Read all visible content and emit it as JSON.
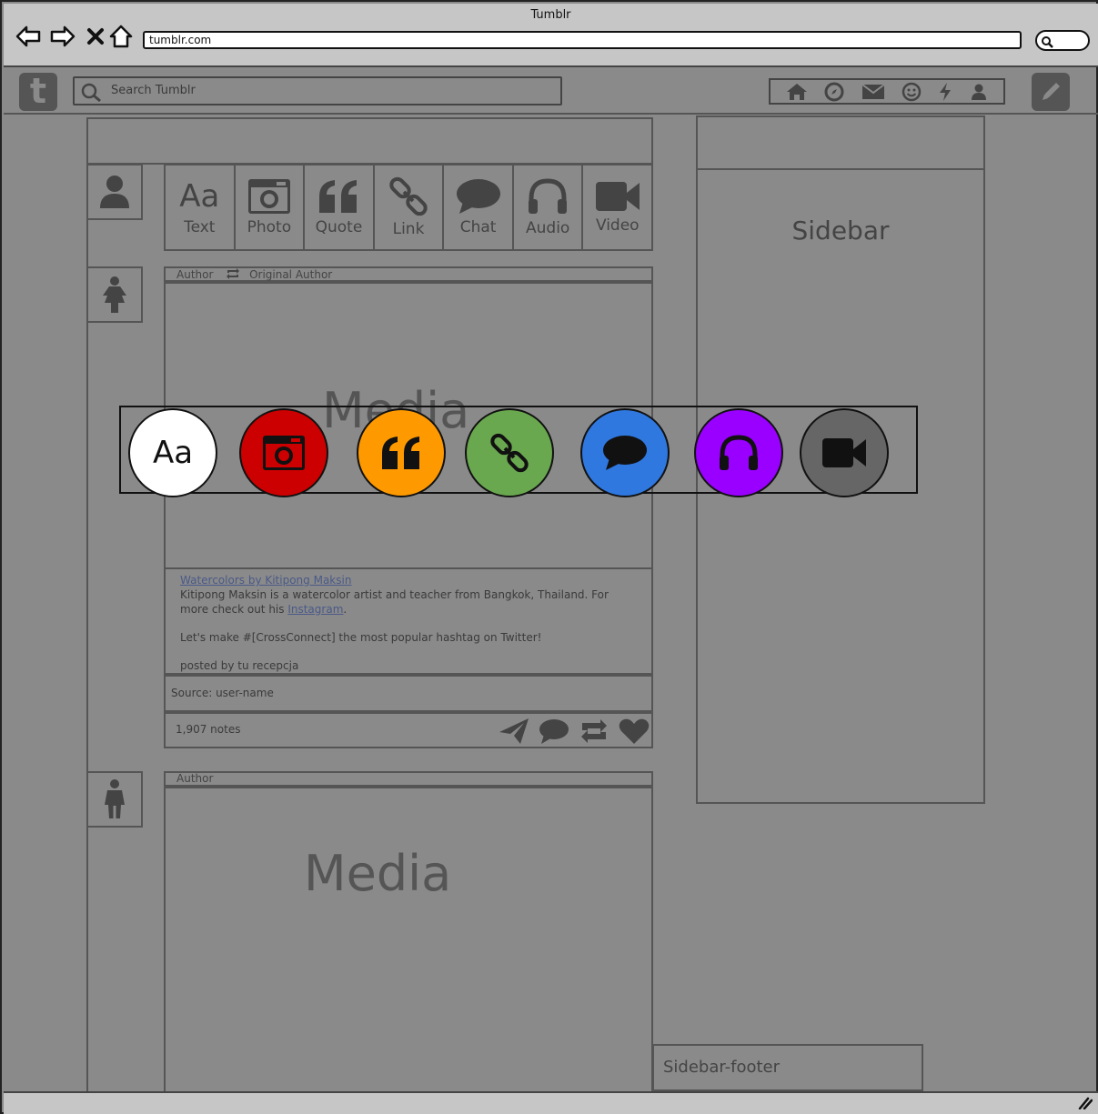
{
  "window": {
    "title": "Tumblr",
    "url": "tumblr.com"
  },
  "header": {
    "search_placeholder": "Search Tumblr"
  },
  "post_types": [
    {
      "label": "Text",
      "glyph": "Aa"
    },
    {
      "label": "Photo"
    },
    {
      "label": "Quote"
    },
    {
      "label": "Link"
    },
    {
      "label": "Chat"
    },
    {
      "label": "Audio"
    },
    {
      "label": "Video"
    }
  ],
  "post1": {
    "author": "Author",
    "original_author": "Original Author",
    "media": "Media",
    "caption_link": "Watercolors by Kitipong Maksin",
    "caption_text": " Kitipong Maksin is a watercolor artist and teacher from Bangkok, Thailand. For more check out his ",
    "caption_link2": "Instagram",
    "caption_period": ".",
    "caption_line2": "Let's make #[CrossConnect] the most popular hashtag on Twitter!",
    "caption_line3": "posted by tu recepcja",
    "source": "Source: user-name",
    "notes": "1,907 notes"
  },
  "post2": {
    "author": "Author",
    "media": "Media"
  },
  "sidebar": {
    "title": "Sidebar",
    "footer": "Sidebar-footer"
  },
  "overlay_colors": {
    "text": "#ffffff",
    "photo": "#cc0000",
    "quote": "#ff9900",
    "link": "#6aa84f",
    "chat": "#2f78e0",
    "audio": "#9900ff",
    "video": "#666666"
  },
  "overlay_glyph": "Aa"
}
